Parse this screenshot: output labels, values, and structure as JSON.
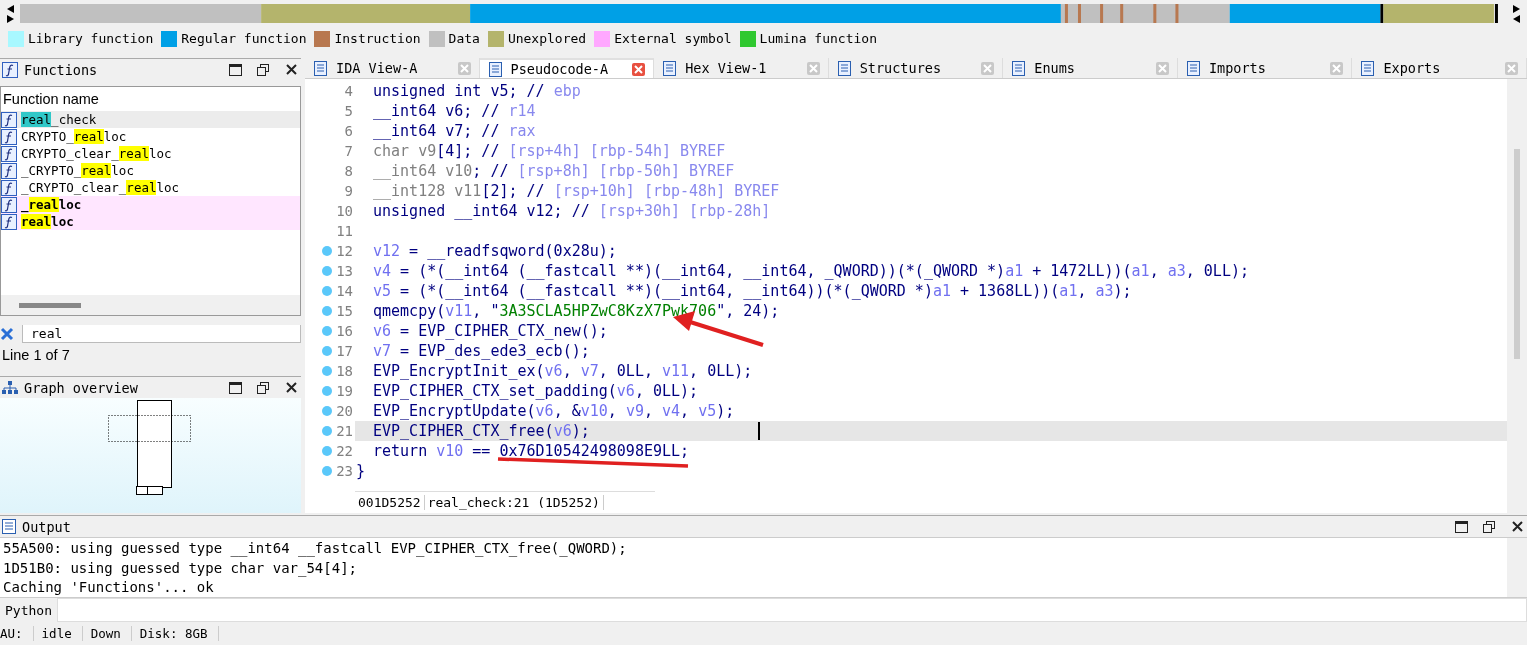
{
  "legend": [
    {
      "label": "Library function",
      "color": "#a8f8ff"
    },
    {
      "label": "Regular function",
      "color": "#00a0e6"
    },
    {
      "label": "Instruction",
      "color": "#b87850"
    },
    {
      "label": "Data",
      "color": "#c0c0c0"
    },
    {
      "label": "Unexplored",
      "color": "#b4b46c"
    },
    {
      "label": "External symbol",
      "color": "#ffa8ff"
    },
    {
      "label": "Lumina function",
      "color": "#30c830"
    }
  ],
  "functions_panel": {
    "title": "Functions",
    "column": "Function name",
    "items": [
      {
        "match": "real",
        "after": "_check",
        "selected": true,
        "bold": false
      },
      {
        "before": "CRYPTO_",
        "match": "real",
        "after": "loc",
        "selected": false,
        "bold": false
      },
      {
        "before": "CRYPTO_clear_",
        "match": "real",
        "after": "loc",
        "selected": false,
        "bold": false
      },
      {
        "before": "_CRYPTO_",
        "match": "real",
        "after": "loc",
        "selected": false,
        "bold": false
      },
      {
        "before": "_CRYPTO_clear_",
        "match": "real",
        "after": "loc",
        "selected": false,
        "bold": false
      },
      {
        "before": "_",
        "match": "real",
        "after": "loc",
        "selected": false,
        "bold": true
      },
      {
        "match": "real",
        "after": "loc",
        "selected": false,
        "bold": true
      }
    ],
    "filter": "real",
    "line_info": "Line 1 of 7"
  },
  "graph_panel": {
    "title": "Graph overview"
  },
  "tabs": [
    {
      "label": "IDA View-A",
      "selected": false
    },
    {
      "label": "Pseudocode-A",
      "selected": true
    },
    {
      "label": "Hex View-1",
      "selected": false
    },
    {
      "label": "Structures",
      "selected": false
    },
    {
      "label": "Enums",
      "selected": false
    },
    {
      "label": "Imports",
      "selected": false
    },
    {
      "label": "Exports",
      "selected": false
    }
  ],
  "code_lines": [
    {
      "number": "4",
      "kind": "body",
      "breakpoint": false,
      "selected": false,
      "tokens": [
        {
          "kind": "code",
          "text": "unsigned int v5; // "
        },
        {
          "kind": "comment",
          "text": "ebp"
        }
      ]
    },
    {
      "number": "5",
      "kind": "body",
      "breakpoint": false,
      "selected": false,
      "tokens": [
        {
          "kind": "code",
          "text": "__int64 v6; // "
        },
        {
          "kind": "comment",
          "text": "r14"
        }
      ]
    },
    {
      "number": "6",
      "kind": "body",
      "breakpoint": false,
      "selected": false,
      "tokens": [
        {
          "kind": "code",
          "text": "__int64 v7; // "
        },
        {
          "kind": "comment",
          "text": "rax"
        }
      ]
    },
    {
      "number": "7",
      "kind": "body",
      "breakpoint": false,
      "selected": false,
      "tokens": [
        {
          "kind": "unused",
          "text": "char v9"
        },
        {
          "kind": "code",
          "text": "[4]; // "
        },
        {
          "kind": "comment",
          "text": "[rsp+4h] [rbp-54h] BYREF"
        }
      ]
    },
    {
      "number": "8",
      "kind": "body",
      "breakpoint": false,
      "selected": false,
      "tokens": [
        {
          "kind": "unused",
          "text": "__int64 v10"
        },
        {
          "kind": "code",
          "text": "; // "
        },
        {
          "kind": "comment",
          "text": "[rsp+8h] [rbp-50h] BYREF"
        }
      ]
    },
    {
      "number": "9",
      "kind": "body",
      "breakpoint": false,
      "selected": false,
      "tokens": [
        {
          "kind": "unused",
          "text": "__int128 v11"
        },
        {
          "kind": "code",
          "text": "[2]; // "
        },
        {
          "kind": "comment",
          "text": "[rsp+10h] [rbp-48h] BYREF"
        }
      ]
    },
    {
      "number": "10",
      "kind": "body",
      "breakpoint": false,
      "selected": false,
      "tokens": [
        {
          "kind": "code",
          "text": "unsigned __int64 v12; // "
        },
        {
          "kind": "comment",
          "text": "[rsp+30h] [rbp-28h]"
        }
      ]
    },
    {
      "number": "11",
      "kind": "body",
      "breakpoint": false,
      "selected": false
    },
    {
      "number": "12",
      "kind": "body",
      "breakpoint": true,
      "selected": false,
      "tokens": [
        {
          "kind": "var",
          "text": "v12"
        },
        {
          "kind": "code",
          "text": " = __readfsqword(0x28u);"
        }
      ]
    },
    {
      "number": "13",
      "kind": "body",
      "breakpoint": true,
      "selected": false,
      "tokens": [
        {
          "kind": "var",
          "text": "v4"
        },
        {
          "kind": "code",
          "text": " = (*(__int64 (__fastcall **)(__int64, __int64, _QWORD))(*(_QWORD *)"
        },
        {
          "kind": "var",
          "text": "a1"
        },
        {
          "kind": "code",
          "text": " + 1472LL))("
        },
        {
          "kind": "var",
          "text": "a1"
        },
        {
          "kind": "code",
          "text": ", "
        },
        {
          "kind": "var",
          "text": "a3"
        },
        {
          "kind": "code",
          "text": ", 0LL);"
        }
      ]
    },
    {
      "number": "14",
      "kind": "body",
      "breakpoint": true,
      "selected": false,
      "tokens": [
        {
          "kind": "var",
          "text": "v5"
        },
        {
          "kind": "code",
          "text": " = (*(__int64 (__fastcall **)(__int64, __int64))(*(_QWORD *)"
        },
        {
          "kind": "var",
          "text": "a1"
        },
        {
          "kind": "code",
          "text": " + 1368LL))("
        },
        {
          "kind": "var",
          "text": "a1"
        },
        {
          "kind": "code",
          "text": ", "
        },
        {
          "kind": "var",
          "text": "a3"
        },
        {
          "kind": "code",
          "text": ");"
        }
      ]
    },
    {
      "number": "15",
      "kind": "body",
      "breakpoint": true,
      "selected": false,
      "tokens": [
        {
          "kind": "code",
          "text": "qmemcpy("
        },
        {
          "kind": "var",
          "text": "v11"
        },
        {
          "kind": "code",
          "text": ", \""
        },
        {
          "kind": "string",
          "text": "3A3SCLA5HPZwC8KzX7Pwk706"
        },
        {
          "kind": "code",
          "text": "\", 24);"
        }
      ]
    },
    {
      "number": "16",
      "kind": "body",
      "breakpoint": true,
      "selected": false,
      "tokens": [
        {
          "kind": "var",
          "text": "v6"
        },
        {
          "kind": "code",
          "text": " = EVP_CIPHER_CTX_new();"
        }
      ]
    },
    {
      "number": "17",
      "kind": "body",
      "breakpoint": true,
      "selected": false,
      "tokens": [
        {
          "kind": "var",
          "text": "v7"
        },
        {
          "kind": "code",
          "text": " = EVP_des_ede3_ecb();"
        }
      ]
    },
    {
      "number": "18",
      "kind": "body",
      "breakpoint": true,
      "selected": false,
      "tokens": [
        {
          "kind": "code",
          "text": "EVP_EncryptInit_ex("
        },
        {
          "kind": "var",
          "text": "v6"
        },
        {
          "kind": "code",
          "text": ", "
        },
        {
          "kind": "var",
          "text": "v7"
        },
        {
          "kind": "code",
          "text": ", 0LL, "
        },
        {
          "kind": "var",
          "text": "v11"
        },
        {
          "kind": "code",
          "text": ", 0LL);"
        }
      ]
    },
    {
      "number": "19",
      "kind": "body",
      "breakpoint": true,
      "selected": false,
      "tokens": [
        {
          "kind": "code",
          "text": "EVP_CIPHER_CTX_set_padding("
        },
        {
          "kind": "var",
          "text": "v6"
        },
        {
          "kind": "code",
          "text": ", 0LL);"
        }
      ]
    },
    {
      "number": "20",
      "kind": "body",
      "breakpoint": true,
      "selected": false,
      "tokens": [
        {
          "kind": "code",
          "text": "EVP_EncryptUpdate("
        },
        {
          "kind": "var",
          "text": "v6"
        },
        {
          "kind": "code",
          "text": ", &"
        },
        {
          "kind": "var",
          "text": "v10"
        },
        {
          "kind": "code",
          "text": ", "
        },
        {
          "kind": "var",
          "text": "v9"
        },
        {
          "kind": "code",
          "text": ", "
        },
        {
          "kind": "var",
          "text": "v4"
        },
        {
          "kind": "code",
          "text": ", "
        },
        {
          "kind": "var",
          "text": "v5"
        },
        {
          "kind": "code",
          "text": ");"
        }
      ]
    },
    {
      "number": "21",
      "kind": "body",
      "breakpoint": true,
      "selected": true,
      "tokens": [
        {
          "kind": "code",
          "text": "EVP_CIPHER_CTX_free("
        },
        {
          "kind": "var",
          "text": "v6"
        },
        {
          "kind": "code",
          "text": ");"
        }
      ]
    },
    {
      "number": "22",
      "kind": "body",
      "breakpoint": true,
      "selected": false,
      "tokens": [
        {
          "kind": "code",
          "text": "return "
        },
        {
          "kind": "var",
          "text": "v10"
        },
        {
          "kind": "code",
          "text": " == 0x76D10542498098E9LL;"
        }
      ]
    },
    {
      "number": "23",
      "kind": "brace",
      "breakpoint": true,
      "selected": false,
      "tokens": [
        {
          "kind": "code",
          "text": "}"
        }
      ]
    }
  ],
  "editor_status": {
    "address": "001D5252",
    "location": "real_check:21 (1D5252)"
  },
  "output_panel": {
    "title": "Output",
    "lines": [
      "55A500: using guessed type __int64 __fastcall EVP_CIPHER_CTX_free(_QWORD);",
      "1D51B0: using guessed type char var_54[4];",
      "Caching 'Functions'... ok"
    ]
  },
  "command_bar": {
    "language": "Python"
  },
  "status_bar": [
    "AU:",
    "idle",
    "Down",
    "Disk: 8GB"
  ]
}
